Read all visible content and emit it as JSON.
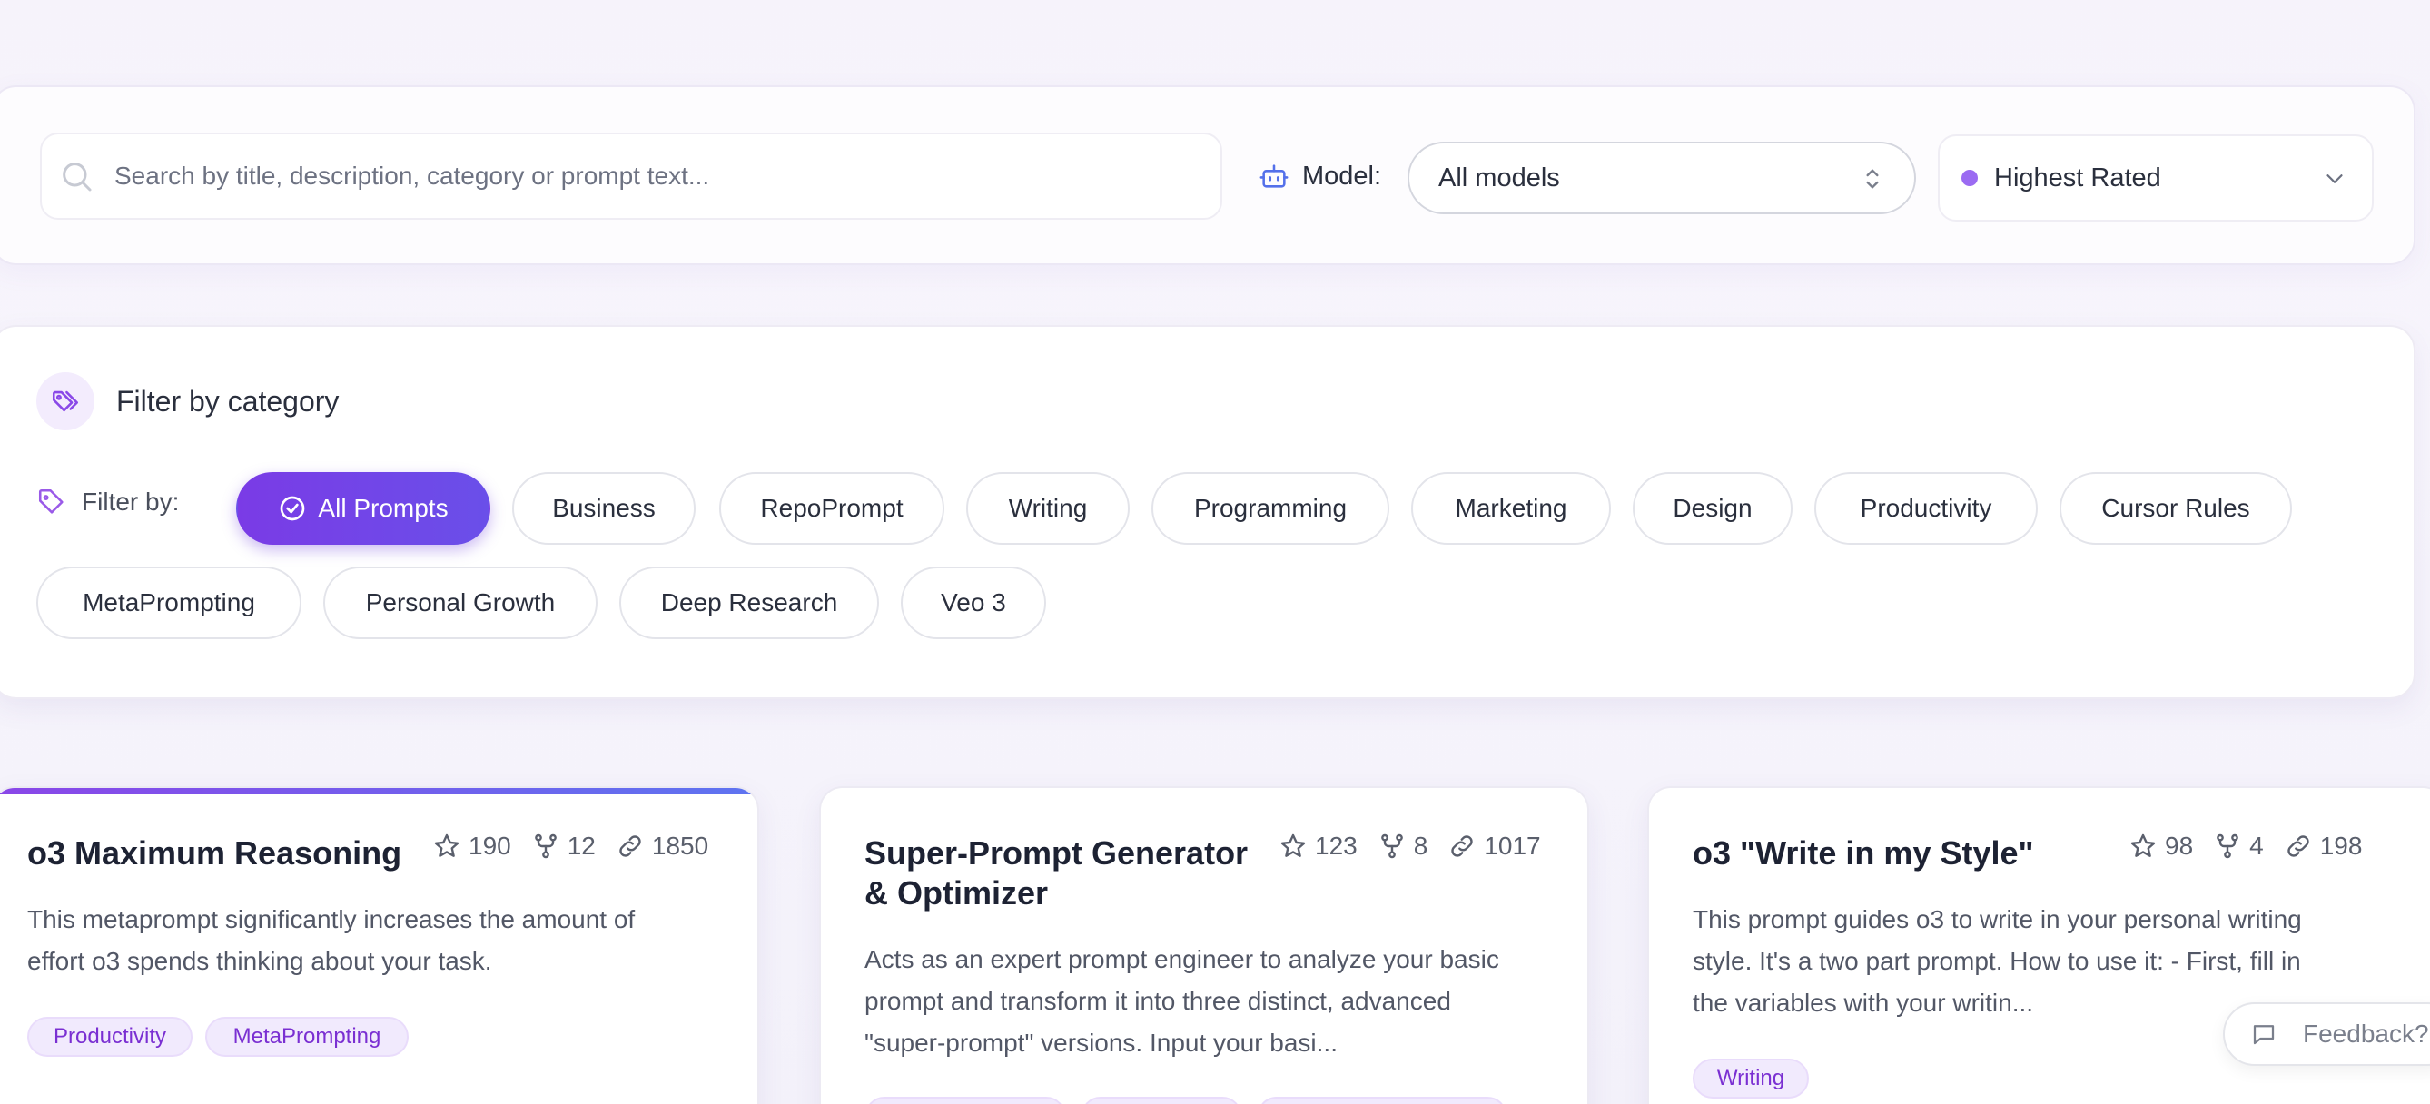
{
  "search": {
    "placeholder": "Search by title, description, category or prompt text...",
    "model_label": "Model:",
    "model_value": "All models",
    "sort_value": "Highest Rated",
    "sort_dot_color": "#9b6bf2"
  },
  "filter": {
    "title": "Filter by category",
    "filter_by_label": "Filter by:",
    "categories": [
      {
        "label": "All Prompts",
        "active": true
      },
      {
        "label": "Business"
      },
      {
        "label": "RepoPrompt"
      },
      {
        "label": "Writing"
      },
      {
        "label": "Programming"
      },
      {
        "label": "Marketing"
      },
      {
        "label": "Design"
      },
      {
        "label": "Productivity"
      },
      {
        "label": "Cursor Rules"
      },
      {
        "label": "MetaPrompting"
      },
      {
        "label": "Personal Growth"
      },
      {
        "label": "Deep Research"
      },
      {
        "label": "Veo 3"
      }
    ]
  },
  "cards": [
    {
      "title": "o3 Maximum Reasoning",
      "stars": "190",
      "forks": "12",
      "links": "1850",
      "description_lines": [
        "This metaprompt significantly increases the amount of",
        "effort o3 spends thinking about your task."
      ],
      "tags": [
        "Productivity",
        "MetaPrompting"
      ]
    },
    {
      "title_lines": [
        "Super-Prompt Generator",
        "& Optimizer"
      ],
      "stars": "123",
      "forks": "8",
      "links": "1017",
      "description_lines": [
        "Acts as an expert prompt engineer to analyze your basic",
        "prompt and transform it into three distinct, advanced",
        "\"super-prompt\" versions. Input your basi..."
      ]
    },
    {
      "title": "o3 \"Write in my Style\"",
      "stars": "98",
      "forks": "4",
      "links": "198",
      "description_lines": [
        "This prompt guides o3 to write in your personal writing",
        "style. It's a two part prompt. How to use it: - First, fill in",
        "the variables with your writin..."
      ],
      "tags": [
        "Writing"
      ]
    }
  ],
  "feedback": {
    "label": "Feedback?"
  },
  "colors": {
    "accent": "#7a3be6",
    "tag_text": "#7a2fd2",
    "tag_bg": "#f1eafd"
  }
}
